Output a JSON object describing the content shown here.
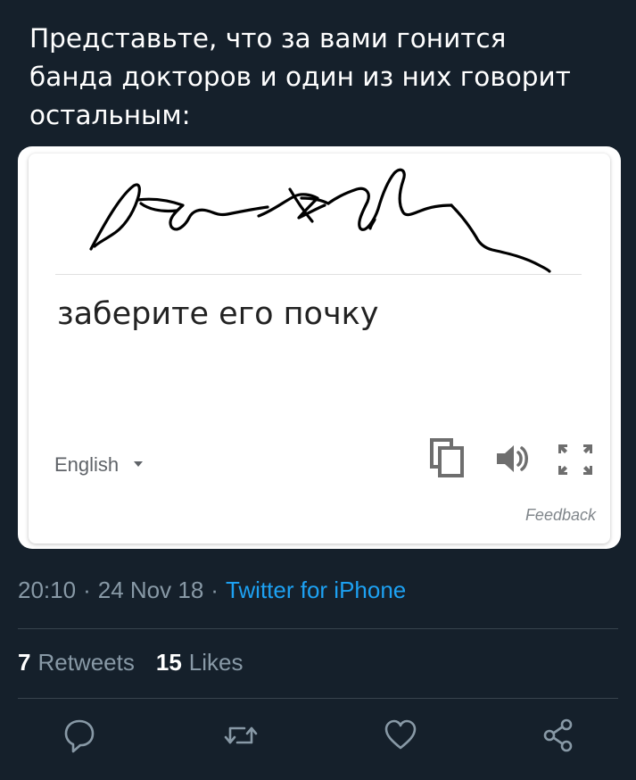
{
  "tweet": {
    "text_line1": "Представьте, что за вами гонится",
    "text_line2": "банда докторов и один из них говорит",
    "text_line3": "остальным:"
  },
  "translate_card": {
    "translation": "заберите его почку",
    "language": "English",
    "feedback_label": "Feedback",
    "icons": [
      "copy-icon",
      "speaker-icon",
      "fullscreen-icon"
    ]
  },
  "meta": {
    "time": "20:10",
    "separator": "·",
    "date": "24 Nov 18",
    "source": "Twitter for iPhone"
  },
  "stats": {
    "retweets_count": "7",
    "retweets_label": "Retweets",
    "likes_count": "15",
    "likes_label": "Likes"
  },
  "actions": [
    "reply-icon",
    "retweet-icon",
    "like-icon",
    "share-icon"
  ],
  "colors": {
    "background": "#15202b",
    "secondary_text": "#8899a6",
    "link": "#1da1f2",
    "divider": "#38444d"
  }
}
